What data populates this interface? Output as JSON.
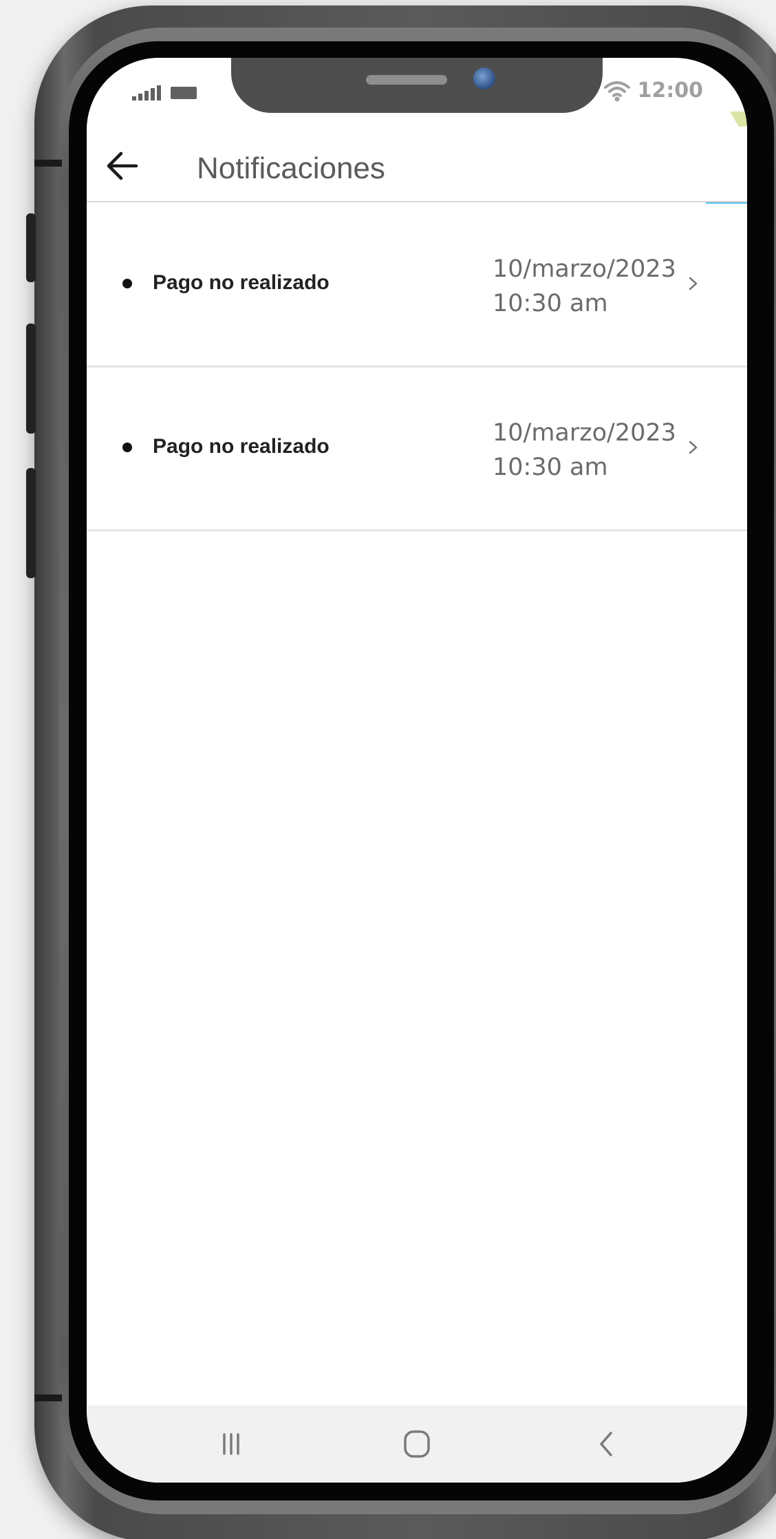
{
  "status_bar": {
    "time": "12:00"
  },
  "header": {
    "title": "Notificaciones"
  },
  "notifications": [
    {
      "title": "Pago no realizado",
      "date": "10/marzo/2023",
      "time": "10:30 am"
    },
    {
      "title": "Pago no realizado",
      "date": "10/marzo/2023",
      "time": "10:30 am"
    }
  ],
  "icons": {
    "back": "arrow-left-icon",
    "chevron": "chevron-right-icon",
    "wifi": "wifi-icon",
    "signal": "signal-icon",
    "battery": "battery-icon",
    "recents": "recents-icon",
    "home": "home-icon",
    "nav_back": "nav-back-icon"
  },
  "colors": {
    "accent_blue": "#4fc1ee",
    "accent_green": "#dce5a7"
  }
}
